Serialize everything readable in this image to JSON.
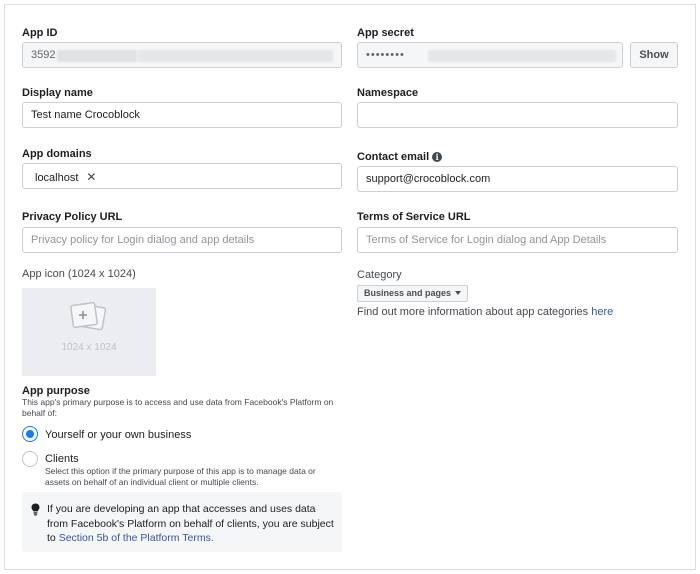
{
  "left": {
    "app_id": {
      "label": "App ID",
      "value": "3592"
    },
    "display_name": {
      "label": "Display name",
      "value": "Test name Crocoblock"
    },
    "app_domains": {
      "label": "App domains",
      "chip": "localhost"
    },
    "privacy_policy": {
      "label": "Privacy Policy URL",
      "placeholder": "Privacy policy for Login dialog and app details"
    },
    "app_icon": {
      "label": "App icon (1024 x 1024)",
      "caption": "1024 x 1024"
    },
    "app_purpose": {
      "label": "App purpose",
      "description": "This app's primary purpose is to access and use data from Facebook's Platform on behalf of:",
      "options": [
        {
          "label": "Yourself or your own business",
          "selected": true
        },
        {
          "label": "Clients",
          "description": "Select this option if the primary purpose of this app is to manage data or assets on behalf of an individual client or multiple clients.",
          "selected": false
        }
      ],
      "note_text": "If you are developing an app that accesses and uses data from Facebook's Platform on behalf of clients, you are subject to",
      "note_link": "Section 5b of the Platform Terms."
    }
  },
  "right": {
    "app_secret": {
      "label": "App secret",
      "value": "••••••••",
      "show_button": "Show"
    },
    "namespace": {
      "label": "Namespace",
      "value": ""
    },
    "contact_email": {
      "label": "Contact email",
      "value": "support@crocoblock.com",
      "info_icon": "i"
    },
    "terms_of_service": {
      "label": "Terms of Service URL",
      "placeholder": "Terms of Service for Login dialog and App Details"
    },
    "category": {
      "label": "Category",
      "selected": "Business and pages",
      "info_text": "Find out more information about app categories",
      "info_link": "here"
    }
  },
  "colors": {
    "accent": "#1877f2",
    "link": "#385898",
    "border": "#ccd0d5"
  },
  "icons": [
    "close-icon",
    "info-icon",
    "chevron-down-icon",
    "image-placeholder-icon",
    "lightbulb-icon"
  ]
}
